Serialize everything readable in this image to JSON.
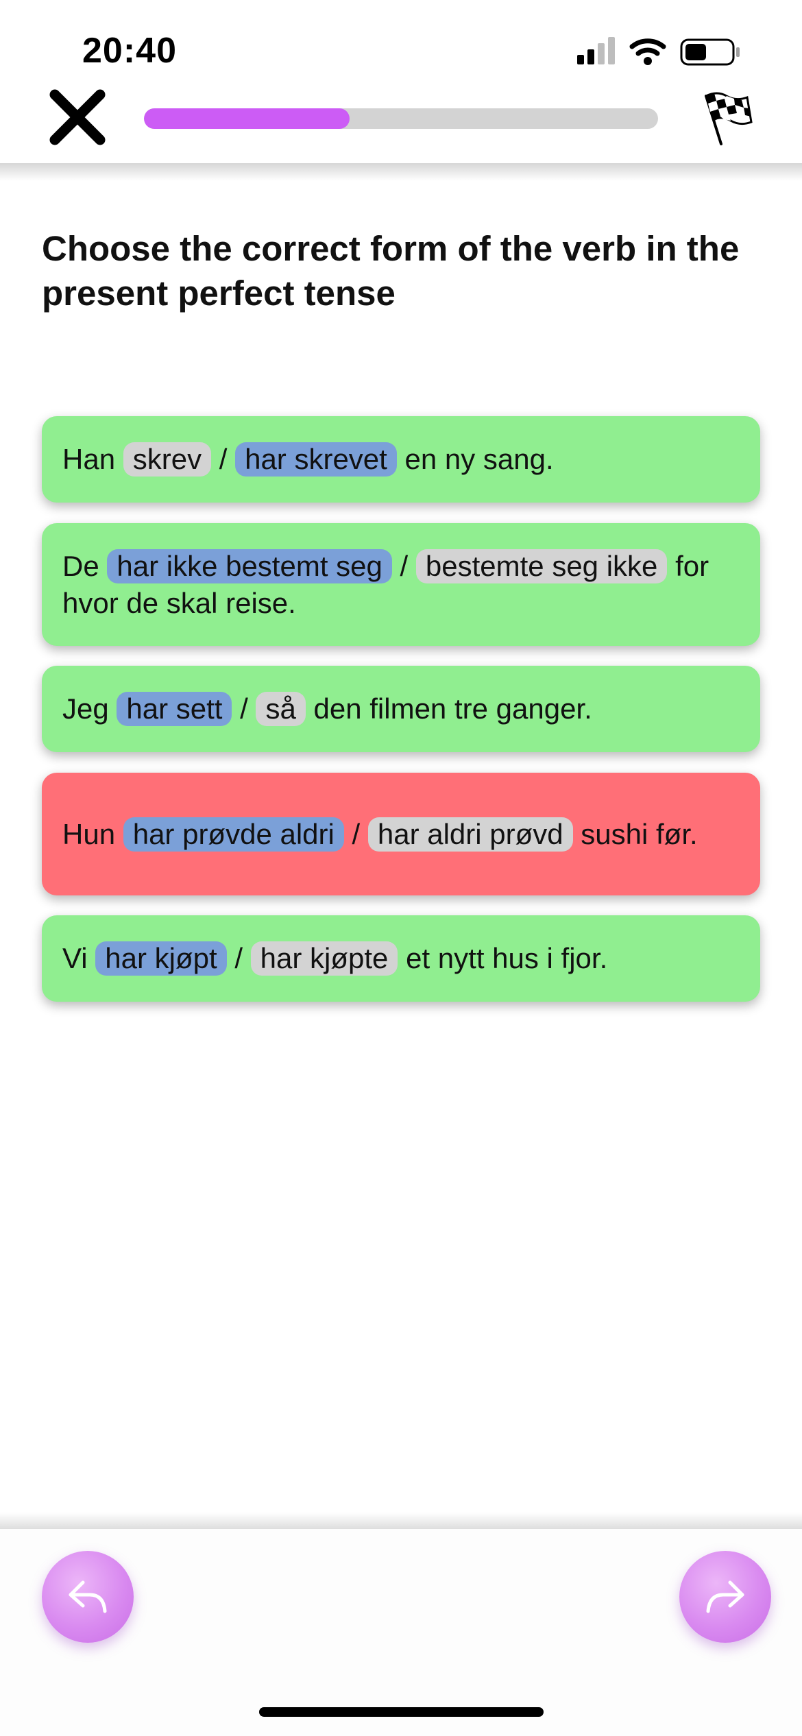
{
  "status_bar": {
    "time": "20:40"
  },
  "header": {
    "close_icon": "close-icon",
    "progress_fraction": 0.4,
    "progress_color": "#cc5cf5",
    "finish_icon": "checkered-flag-icon"
  },
  "question": {
    "title": "Choose the correct form of the verb in the present perfect tense"
  },
  "items": [
    {
      "state": "correct",
      "before": "Han ",
      "option_a": "skrev",
      "option_a_selected": false,
      "separator": " / ",
      "option_b": "har skrevet",
      "option_b_selected": true,
      "after": " en ny sang."
    },
    {
      "state": "correct",
      "before": "De ",
      "option_a": "har ikke bestemt seg",
      "option_a_selected": true,
      "separator": " / ",
      "option_b": "bestemte seg ikke",
      "option_b_selected": false,
      "after": " for hvor de skal reise."
    },
    {
      "state": "correct",
      "before": "Jeg ",
      "option_a": "har sett",
      "option_a_selected": true,
      "separator": " / ",
      "option_b": "så",
      "option_b_selected": false,
      "after": " den filmen tre ganger."
    },
    {
      "state": "wrong",
      "before": "Hun ",
      "option_a": "har prøvde aldri",
      "option_a_selected": true,
      "separator": " / ",
      "option_b": "har aldri prøvd",
      "option_b_selected": false,
      "after": " sushi før."
    },
    {
      "state": "correct",
      "before": "Vi ",
      "option_a": "har kjøpt",
      "option_a_selected": true,
      "separator": " / ",
      "option_b": "har kjøpte",
      "option_b_selected": false,
      "after": " et nytt hus i fjor."
    }
  ],
  "colors": {
    "correct": "#90ee90",
    "wrong": "#ff6f77",
    "selected_chip": "#7ba0d8",
    "unselected_chip": "#d3d3d3"
  },
  "footer": {
    "back_icon": "undo-arrow-icon",
    "forward_icon": "redo-arrow-icon"
  }
}
